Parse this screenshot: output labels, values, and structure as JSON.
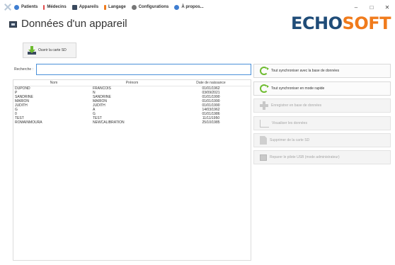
{
  "menubar": {
    "items": [
      {
        "label": "Patients",
        "icon": "patients-icon",
        "color": "#3f7ed1"
      },
      {
        "label": "Médecins",
        "icon": "doctor-icon",
        "color": "#e04b4b"
      },
      {
        "label": "Appareils",
        "icon": "device-icon",
        "color": "#3a4a5e"
      },
      {
        "label": "Langage",
        "icon": "language-icon",
        "color": "#f07b1c"
      },
      {
        "label": "Configurations",
        "icon": "gear-icon",
        "color": "#777777"
      },
      {
        "label": "À propos...",
        "icon": "info-icon",
        "color": "#3f7ed1"
      }
    ],
    "window_controls": [
      "–",
      "□",
      "✕"
    ]
  },
  "header": {
    "title": "Données d'un appareil",
    "logo_part1": "ECHO",
    "logo_part2": "SOFT",
    "logo_colors": {
      "echo": "#1f4c78",
      "soft": "#f07b1c"
    }
  },
  "open_sd_button": {
    "label": "Ouvrir la carte SD"
  },
  "search": {
    "label": "Recherche :",
    "value": "",
    "placeholder": ""
  },
  "table": {
    "headers": [
      "Nom",
      "Prénom",
      "Date de naissance"
    ],
    "rows": [
      [
        "DUPOND",
        "FRANCOIS",
        "01/01/1962"
      ],
      [
        "P",
        "N",
        "03/09/2021"
      ],
      [
        "SANDRINE",
        "SANDRINE",
        "01/01/1990"
      ],
      [
        "MARION",
        "MARION",
        "01/01/1990"
      ],
      [
        "JUDITH",
        "JUDITH",
        "01/01/1990"
      ],
      [
        "G",
        "A",
        "14/03/1962"
      ],
      [
        "0",
        "G",
        "01/01/1986"
      ],
      [
        "TEST",
        "TEST",
        "11/11/1950"
      ],
      [
        "ROMAINMOURA",
        "NEWCALIBRATION",
        "25/10/1985"
      ]
    ]
  },
  "actions": [
    {
      "label": "Tout synchroniser avec la base de données",
      "icon": "sync-icon",
      "enabled": true
    },
    {
      "label": "Tout synchroniser en mode rapide",
      "icon": "sync-fast-icon",
      "enabled": true
    },
    {
      "label": "Enregistrer en base de données",
      "icon": "plus-icon",
      "enabled": false
    },
    {
      "label": "Visualiser les données",
      "icon": "chart-icon",
      "enabled": false
    },
    {
      "label": "Supprimer de la carte SD",
      "icon": "sd-card-icon",
      "enabled": false
    },
    {
      "label": "Reparer le pilote USB (mode administrateur)",
      "icon": "usb-icon",
      "enabled": false
    }
  ]
}
